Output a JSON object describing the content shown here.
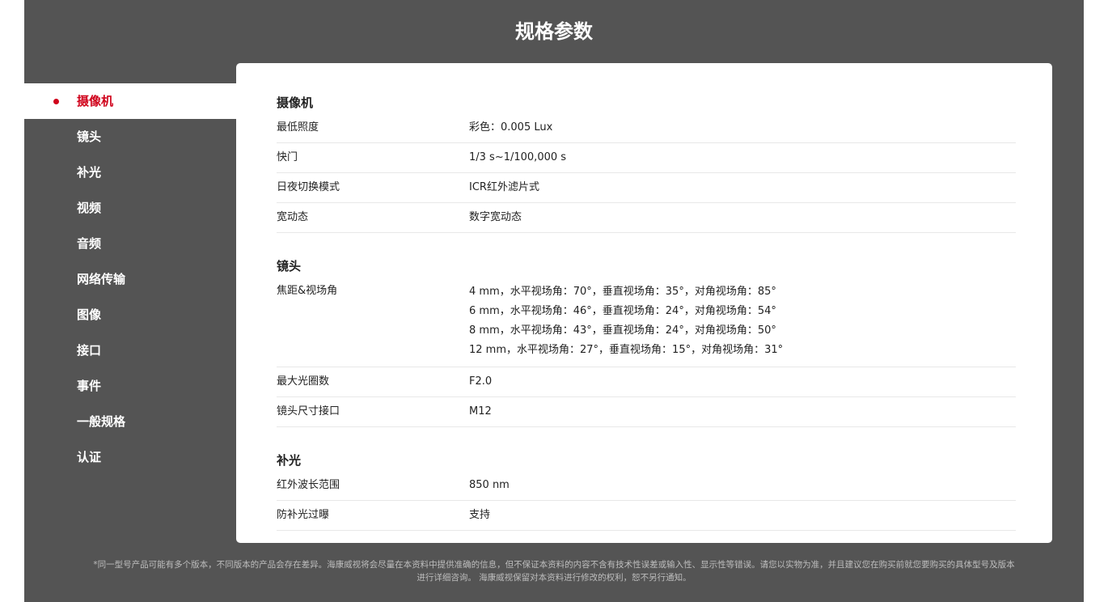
{
  "page": {
    "title": "规格参数"
  },
  "sidebar": {
    "items": [
      {
        "label": "摄像机"
      },
      {
        "label": "镜头"
      },
      {
        "label": "补光"
      },
      {
        "label": "视频"
      },
      {
        "label": "音频"
      },
      {
        "label": "网络传输"
      },
      {
        "label": "图像"
      },
      {
        "label": "接口"
      },
      {
        "label": "事件"
      },
      {
        "label": "一般规格"
      },
      {
        "label": "认证"
      }
    ],
    "active_index": 0
  },
  "specs": {
    "camera": {
      "title": "摄像机",
      "rows": [
        {
          "key": "最低照度",
          "value": "彩色：0.005 Lux"
        },
        {
          "key": "快门",
          "value": "1/3 s~1/100,000 s"
        },
        {
          "key": "日夜切换模式",
          "value": "ICR红外滤片式"
        },
        {
          "key": "宽动态",
          "value": "数字宽动态"
        }
      ]
    },
    "lens": {
      "title": "镜头",
      "focal": {
        "key": "焦距&视场角",
        "lines": [
          "4 mm，水平视场角：70°，垂直视场角：35°，对角视场角：85°",
          "6 mm，水平视场角：46°，垂直视场角：24°，对角视场角：54°",
          "8 mm，水平视场角：43°，垂直视场角：24°，对角视场角：50°",
          "12 mm，水平视场角：27°，垂直视场角：15°，对角视场角：31°"
        ]
      },
      "rows": [
        {
          "key": "最大光圈数",
          "value": "F2.0"
        },
        {
          "key": "镜头尺寸接口",
          "value": "M12"
        }
      ]
    },
    "fill_light": {
      "title": "补光",
      "rows": [
        {
          "key": "红外波长范围",
          "value": "850 nm"
        },
        {
          "key": "防补光过曝",
          "value": "支持"
        }
      ]
    }
  },
  "footer": {
    "line1": "*同一型号产品可能有多个版本，不同版本的产品会存在差异。海康威视将会尽量在本资料中提供准确的信息，但不保证本资料的内容不含有技术性误差或输入性、显示性等错误。请您以实物为准，并且建议您在购买前就您要购买的具体型号及版本",
    "line2": "进行详细咨询。 海康威视保留对本资料进行修改的权利，恕不另行通知。"
  },
  "colors": {
    "accent": "#d0021b",
    "panel": "#545454",
    "card": "#ffffff"
  }
}
